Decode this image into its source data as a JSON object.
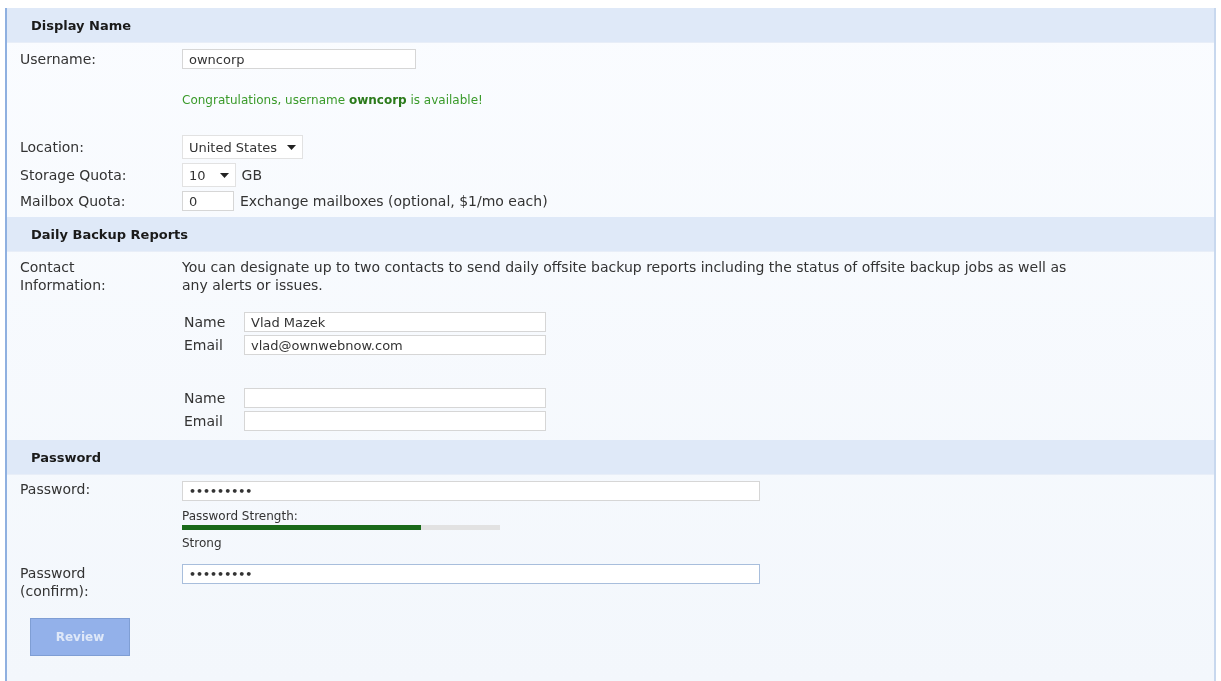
{
  "sections": [
    {
      "title": "Display Name",
      "kind": "account"
    },
    {
      "title": "Daily Backup Reports",
      "kind": "contacts"
    },
    {
      "title": "Password",
      "kind": "password"
    }
  ],
  "username": {
    "label": "Username:",
    "value": "owncorp",
    "message": "Congratulations, username **owncorp** is available!"
  },
  "location": {
    "label": "Location:",
    "value": "United States"
  },
  "storage_quota": {
    "label": "Storage Quota:",
    "value": "10",
    "unit": "GB"
  },
  "mailbox_quota": {
    "label": "Mailbox Quota:",
    "value": "0",
    "note": "Exchange mailboxes (optional, $1/mo each)"
  },
  "contact_information": {
    "label": "Contact Information:",
    "description": "You can designate up to two contacts to send daily offsite backup reports including the status of offsite backup jobs as well as any alerts or issues.",
    "contacts": [
      {
        "name_label": "Name",
        "name": "Vlad Mazek",
        "email_label": "Email",
        "email": "vlad@ownwebnow.com"
      },
      {
        "name_label": "Name",
        "email_label": "Email"
      }
    ]
  },
  "password": {
    "label": "Password:",
    "value": "•••••••••",
    "strength_label": "Password Strength:",
    "level": 0.75,
    "strength": "Strong"
  },
  "password_confirm": {
    "label": "Password (confirm):",
    "value": "•••••••••"
  },
  "buttons": [
    {
      "label": "Review",
      "disabled": true
    }
  ]
}
